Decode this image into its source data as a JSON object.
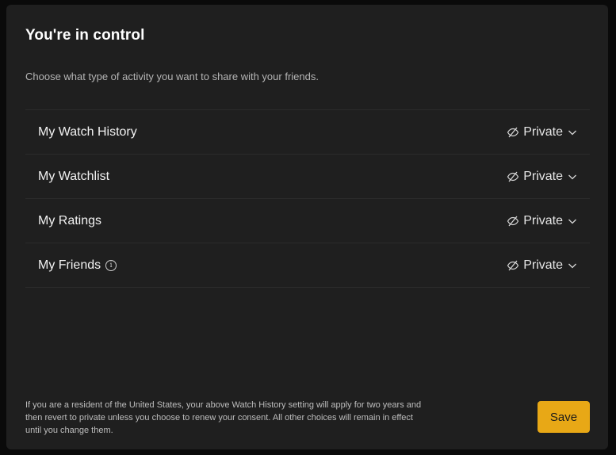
{
  "modal": {
    "title": "You're in control",
    "subtitle": "Choose what type of activity you want to share with your friends.",
    "rows": [
      {
        "label": "My Watch History",
        "value": "Private",
        "icon": "eye-slash-icon"
      },
      {
        "label": "My Watchlist",
        "value": "Private",
        "icon": "eye-slash-icon"
      },
      {
        "label": "My Ratings",
        "value": "Private",
        "icon": "eye-slash-icon"
      },
      {
        "label": "My Friends",
        "value": "Private",
        "icon": "eye-slash-icon",
        "info_icon": "info-icon",
        "info_glyph": "i"
      }
    ],
    "disclaimer": "If you are a resident of the United States, your above Watch History setting will apply for two years and then revert to private unless you choose to renew your consent. All other choices will remain in effect until you change them.",
    "save_label": "Save"
  },
  "colors": {
    "accent": "#e8a816",
    "panel_bg": "#1f1f1f",
    "divider": "#2b2b2b"
  }
}
